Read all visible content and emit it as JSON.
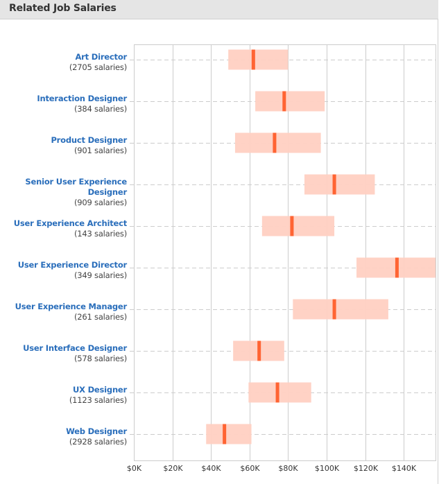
{
  "header": {
    "title": "Related Job Salaries"
  },
  "colors": {
    "range_fill": "#ffd0c2",
    "median_fill": "#ff6433",
    "link": "#2a6ebb",
    "grid": "#cccccc",
    "header_bg": "#e5e5e5"
  },
  "chart_data": {
    "type": "range-bar",
    "title": "Related Job Salaries",
    "xlabel": "",
    "ylabel": "",
    "xlim": [
      0,
      156.5
    ],
    "x_unit": "thousand USD",
    "x_ticks": [
      0,
      20,
      40,
      60,
      80,
      100,
      120,
      140
    ],
    "x_tick_labels": [
      "$0K",
      "$20K",
      "$40K",
      "$60K",
      "$80K",
      "$100K",
      "$120K",
      "$140K"
    ],
    "grid": {
      "vertical": true,
      "horizontal_dashed": true
    },
    "rows": [
      {
        "title_lines": [
          "Art Director"
        ],
        "count_label": "(2705 salaries)",
        "min": 49,
        "median": 62,
        "max": 80
      },
      {
        "title_lines": [
          "Interaction Designer"
        ],
        "count_label": "(384 salaries)",
        "min": 63,
        "median": 78,
        "max": 99
      },
      {
        "title_lines": [
          "Product Designer"
        ],
        "count_label": "(901 salaries)",
        "min": 52.5,
        "median": 73,
        "max": 97
      },
      {
        "title_lines": [
          "Senior User Experience",
          "Designer"
        ],
        "count_label": "(909 salaries)",
        "min": 88.5,
        "median": 104,
        "max": 125
      },
      {
        "title_lines": [
          "User Experience Architect"
        ],
        "count_label": "(143 salaries)",
        "min": 66.5,
        "median": 82,
        "max": 104
      },
      {
        "title_lines": [
          "User Experience Director"
        ],
        "count_label": "(349 salaries)",
        "min": 115.5,
        "median": 136.5,
        "max": 160
      },
      {
        "title_lines": [
          "User Experience Manager"
        ],
        "count_label": "(261 salaries)",
        "min": 82.5,
        "median": 104,
        "max": 132
      },
      {
        "title_lines": [
          "User Interface Designer"
        ],
        "count_label": "(578 salaries)",
        "min": 51.5,
        "median": 65,
        "max": 78
      },
      {
        "title_lines": [
          "UX Designer"
        ],
        "count_label": "(1123 salaries)",
        "min": 59.5,
        "median": 74.5,
        "max": 92
      },
      {
        "title_lines": [
          "Web Designer"
        ],
        "count_label": "(2928 salaries)",
        "min": 37.5,
        "median": 47,
        "max": 61
      }
    ]
  }
}
